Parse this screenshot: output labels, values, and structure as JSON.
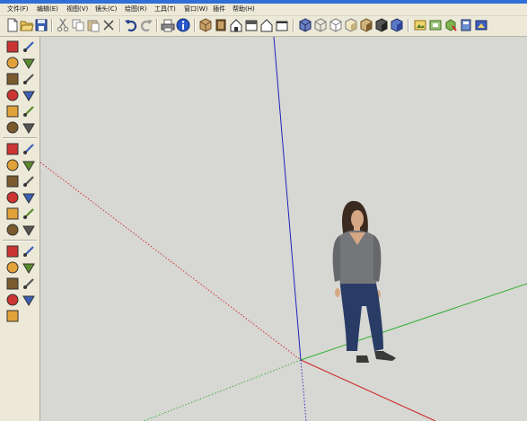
{
  "menus": [
    "文件(F)",
    "编辑(E)",
    "视图(V)",
    "镜头(C)",
    "绘图(R)",
    "工具(T)",
    "窗口(W)",
    "插件",
    "帮助(H)"
  ],
  "colors": {
    "red_axis": "#cc2222",
    "green_axis": "#2fb02f",
    "blue_axis": "#2222bb",
    "canvas": "#d7d7d3",
    "toolbar": "#ece9d8"
  },
  "toolbar_icons": [
    "new-icon",
    "open-icon",
    "save-icon",
    "cut-icon",
    "copy-icon",
    "paste-icon",
    "erase-icon",
    "undo-icon",
    "redo-icon",
    "print-icon",
    "model-info-icon",
    "iso-view-icon",
    "top-view-icon",
    "front-view-icon",
    "right-view-icon",
    "back-view-icon",
    "left-view-icon",
    "xray-icon",
    "wireframe-icon",
    "hidden-line-icon",
    "shaded-icon",
    "shaded-textures-icon",
    "monochrome-icon",
    "warehouse-icon",
    "share-model-icon",
    "components-icon"
  ],
  "left_tools": [
    "select-icon",
    "component-icon",
    "paint-bucket-icon",
    "eraser-icon",
    "rectangle-icon",
    "line-icon",
    "circle-icon",
    "arc-icon",
    "polygon-icon",
    "freehand-icon",
    "move-icon",
    "push-pull-icon",
    "rotate-icon",
    "follow-me-icon",
    "scale-icon",
    "offset-icon",
    "tape-measure-icon",
    "dimension-icon",
    "protractor-icon",
    "text-icon",
    "axes-icon",
    "3d-text-icon",
    "section-plane-icon",
    "section-display-icon",
    "orbit-icon",
    "pan-icon",
    "zoom-icon",
    "zoom-window-icon",
    "zoom-extents-icon",
    "previous-view-icon",
    "position-camera-icon",
    "walk-icon",
    "look-around-icon"
  ]
}
